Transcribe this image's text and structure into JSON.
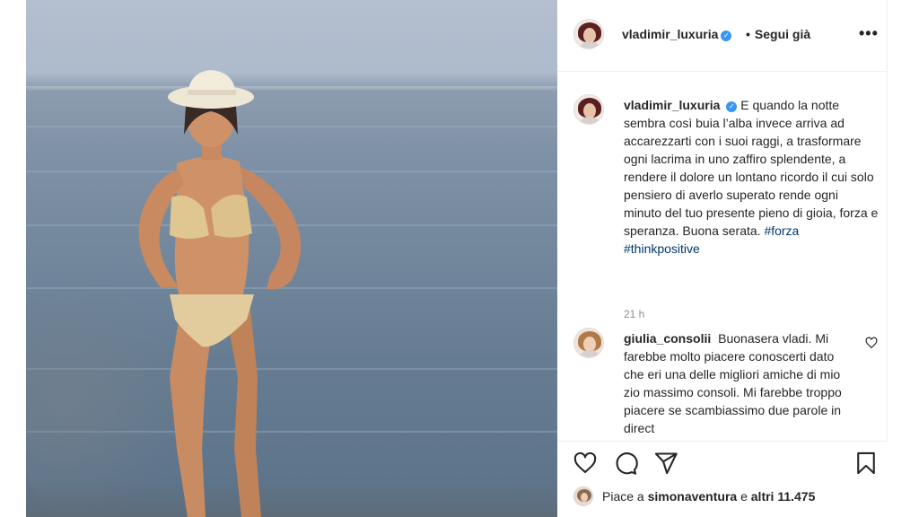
{
  "post": {
    "author": {
      "username": "vladimir_luxuria",
      "verified": true,
      "follow_dot": "•",
      "follow_label": "Segui già",
      "more_label": "•••"
    },
    "caption": {
      "username": "vladimir_luxuria",
      "text": "E quando la notte sembra così buia l’alba invece arriva ad accarezzarti con i suoi raggi, a trasformare ogni lacrima in uno zaffiro splendente, a rendere il dolore un lontano ricordo il cui solo pensiero di averlo superato rende ogni minuto del tuo presente pieno di gioia, forza e speranza. Buona serata.",
      "hashtags": [
        "#forza",
        "#thinkpositive"
      ],
      "time": "21 h"
    },
    "comments": [
      {
        "username": "giulia_consolii",
        "text": "Buonasera vladi. Mi farebbe molto piacere conoscerti dato che eri una delle migliori amiche di mio zio massimo consoli. Mi farebbe troppo piacere se scambiassimo due parole in direct"
      }
    ],
    "likes": {
      "prefix": "Piace a",
      "first_user": "simonaventura",
      "conjunction": "e",
      "others": "altri 11.475"
    }
  },
  "icons": {
    "like": "heart-icon",
    "comment": "comment-icon",
    "share": "paper-plane-icon",
    "save": "bookmark-icon",
    "verified": "verified-badge-icon",
    "comment_like": "heart-icon"
  },
  "colors": {
    "text": "#262626",
    "secondary": "#8e8e8e",
    "hashtag": "#00376b",
    "verified": "#3897f0",
    "divider": "#efefef"
  }
}
